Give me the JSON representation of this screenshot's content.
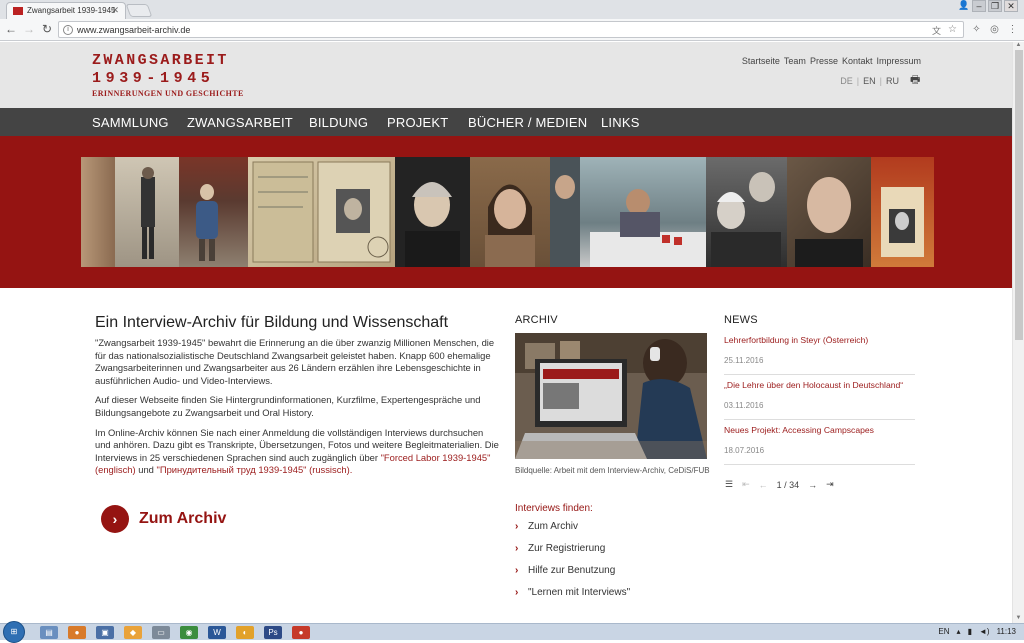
{
  "browser": {
    "tab_title": "Zwangsarbeit 1939-1945",
    "url": "www.zwangsarbeit-archiv.de"
  },
  "site": {
    "logo": {
      "line1": "ZWANGSARBEIT",
      "line2": "1939-1945",
      "line3": "ERINNERUNGEN UND GESCHICHTE"
    },
    "top_links": [
      "Startseite",
      "Team",
      "Presse",
      "Kontakt",
      "Impressum"
    ],
    "languages": [
      "DE",
      "EN",
      "RU"
    ],
    "nav": [
      "SAMMLUNG",
      "ZWANGSARBEIT",
      "BILDUNG",
      "PROJEKT",
      "BÜCHER / MEDIEN",
      "LINKS"
    ]
  },
  "intro": {
    "title": "Ein Interview-Archiv für Bildung und Wissenschaft",
    "p1": "\"Zwangsarbeit 1939-1945\" bewahrt die Erinnerung an die über zwanzig Millionen Menschen, die für das nationalsozialistische Deutschland Zwangsarbeit geleistet haben. Knapp 600 ehemalige Zwangsarbeiterinnen und Zwangsarbeiter aus 26 Ländern erzählen ihre Lebensgeschichte in ausführlichen Audio- und Video-Interviews.",
    "p2": "Auf dieser Webseite finden Sie Hintergrundinformationen, Kurzfilme, Expertengespräche und Bildungsangebote zu Zwangsarbeit und Oral History.",
    "p3_start": "Im Online-Archiv können Sie nach einer Anmeldung die vollständigen Interviews durchsuchen und anhören. Dazu gibt es Transkripte, Übersetzungen, Fotos und weitere Begleitmaterialien. Die Interviews in 25 verschiedenen Sprachen sind auch zugänglich über ",
    "p3_link1": "\"Forced Labor 1939-1945\" (englisch)",
    "p3_mid": " und ",
    "p3_link2": "\"Принудительный труд 1939-1945\" (russisch).",
    "cta": "Zum Archiv"
  },
  "archiv": {
    "title": "ARCHIV",
    "caption": "Bildquelle: Arbeit mit dem Interview-Archiv, CeDiS/FUB",
    "finden_title": "Interviews finden:",
    "links": [
      "Zum Archiv",
      "Zur Registrierung",
      "Hilfe zur Benutzung",
      "\"Lernen mit Interviews\""
    ]
  },
  "news": {
    "title": "NEWS",
    "items": [
      {
        "title": "Lehrerfortbildung in Steyr (Österreich)",
        "date": "25.11.2016"
      },
      {
        "title": "„Die Lehre über den Holocaust in Deutschland“",
        "date": "03.11.2016"
      },
      {
        "title": "Neues Projekt: Accessing Campscapes",
        "date": "18.07.2016"
      }
    ],
    "pager": "1 / 34"
  },
  "taskbar": {
    "lang": "EN",
    "time": "11:13"
  },
  "colors": {
    "brand_red": "#951412",
    "nav_bg": "#444444",
    "header_bg": "#e6e6e6"
  }
}
